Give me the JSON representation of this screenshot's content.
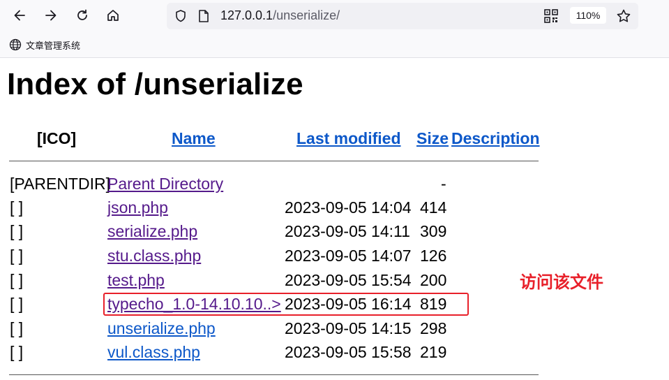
{
  "browser": {
    "url_host": "127.0.0.1",
    "url_path": "/unserialize/",
    "zoom": "110%",
    "bookmark_label": "文章管理系统"
  },
  "page": {
    "title": "Index of /unserialize",
    "headers": {
      "ico": "[ICO]",
      "name": "Name",
      "last_modified": "Last modified",
      "size": "Size",
      "description": "Description"
    },
    "rows": [
      {
        "icon": "[PARENTDIR]",
        "name": "Parent Directory",
        "modified": "",
        "size": "-"
      },
      {
        "icon": "[ ]",
        "name": "json.php",
        "modified": "2023-09-05 14:04",
        "size": "414"
      },
      {
        "icon": "[ ]",
        "name": "serialize.php",
        "modified": "2023-09-05 14:11",
        "size": "309"
      },
      {
        "icon": "[ ]",
        "name": "stu.class.php",
        "modified": "2023-09-05 14:07",
        "size": "126"
      },
      {
        "icon": "[ ]",
        "name": "test.php",
        "modified": "2023-09-05 15:54",
        "size": "200"
      },
      {
        "icon": "[ ]",
        "name": "typecho_1.0-14.10.10..>",
        "modified": "2023-09-05 16:14",
        "size": "819"
      },
      {
        "icon": "[ ]",
        "name": "unserialize.php",
        "modified": "2023-09-05 14:15",
        "size": "298"
      },
      {
        "icon": "[ ]",
        "name": "vul.class.php",
        "modified": "2023-09-05 15:58",
        "size": "219"
      }
    ]
  },
  "annotation": {
    "text": "访问该文件",
    "color": "#e8202a"
  },
  "colors": {
    "link_unvisited": "#0d58c9",
    "link_visited": "#551a8b"
  }
}
